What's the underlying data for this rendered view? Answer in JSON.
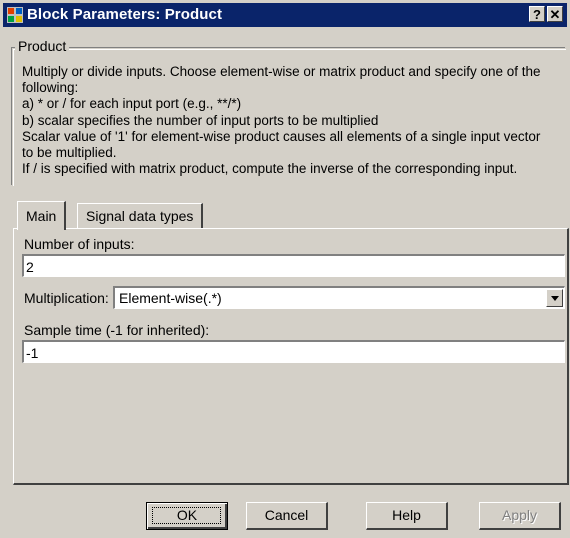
{
  "window": {
    "title": "Block Parameters: Product",
    "help_button": "?",
    "close_button": "✕"
  },
  "group": {
    "legend": "Product",
    "description_lines": [
      "Multiply or divide inputs.  Choose element-wise or matrix product and specify one of the",
      "following:",
      "a) * or / for each input port (e.g., **/*)",
      "b) scalar specifies the number of input ports to be multiplied",
      "Scalar value of '1' for element-wise product causes all elements of a single input vector",
      "to be multiplied.",
      "If / is specified with matrix product, compute the inverse of the corresponding input."
    ]
  },
  "tabs": [
    {
      "label": "Main",
      "active": true
    },
    {
      "label": "Signal data types",
      "active": false
    }
  ],
  "main": {
    "inputs_label": "Number of inputs:",
    "inputs_value": "2",
    "mult_label": "Multiplication:",
    "mult_value": "Element-wise(.*)",
    "sample_label": "Sample time (-1 for inherited):",
    "sample_value": "-1"
  },
  "buttons": {
    "ok": "OK",
    "cancel": "Cancel",
    "help": "Help",
    "apply": "Apply"
  },
  "colors": {
    "titlebar": "#0a246a",
    "face": "#d4d0c8"
  }
}
